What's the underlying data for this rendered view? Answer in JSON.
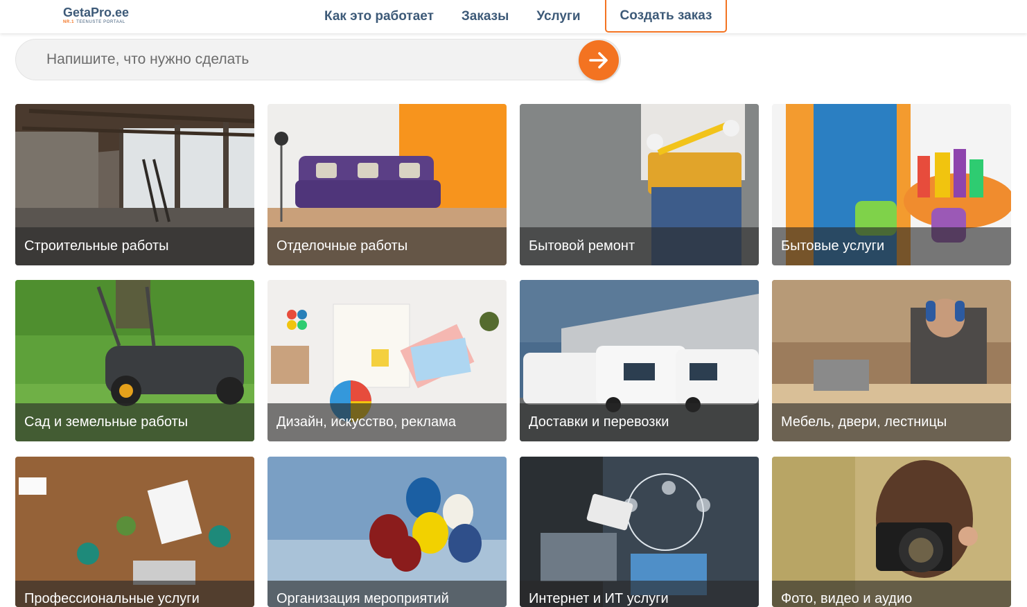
{
  "header": {
    "logo": {
      "name": "GetaPro.ee",
      "tagline_nr": "NR.1",
      "tagline": "TEENUSTE PORTAAL"
    },
    "nav": [
      {
        "label": "Как это работает"
      },
      {
        "label": "Заказы"
      },
      {
        "label": "Услуги"
      }
    ],
    "cta_label": "Создать заказ"
  },
  "search": {
    "placeholder": "Напишите, что нужно сделать",
    "value": "",
    "submit_icon": "arrow-right-icon"
  },
  "colors": {
    "accent": "#f37321",
    "brand_text": "#3d5a78",
    "search_bg": "#f2f2f2"
  },
  "categories": [
    {
      "label": "Строительные работы"
    },
    {
      "label": "Отделочные работы"
    },
    {
      "label": "Бытовой ремонт"
    },
    {
      "label": "Бытовые услуги"
    },
    {
      "label": "Сад и земельные работы"
    },
    {
      "label": "Дизайн, искусство, реклама"
    },
    {
      "label": "Доставки и перевозки"
    },
    {
      "label": "Мебель, двери, лестницы"
    },
    {
      "label": "Профессиональные услуги"
    },
    {
      "label": "Организация мероприятий"
    },
    {
      "label": "Интернет и ИТ услуги"
    },
    {
      "label": "Фото, видео и аудио"
    }
  ]
}
